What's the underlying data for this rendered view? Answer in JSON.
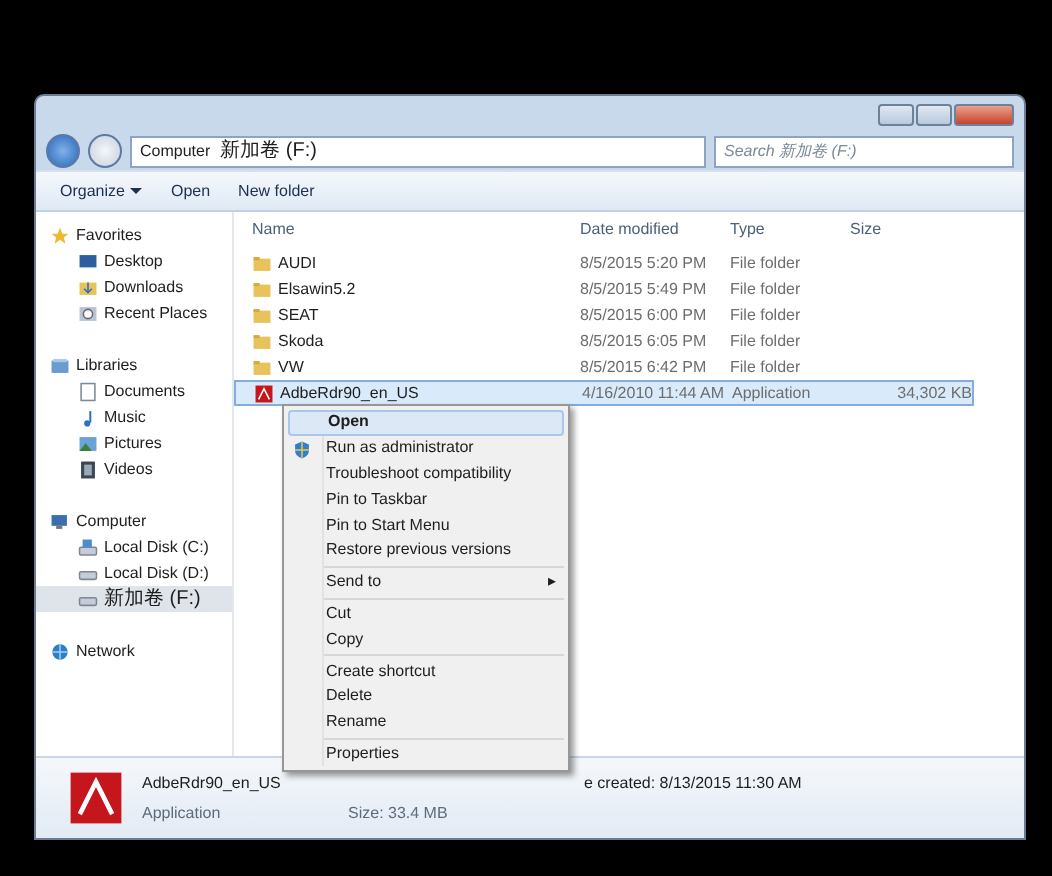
{
  "address": {
    "crumbs": [
      "Computer",
      "新加卷 (F:)"
    ]
  },
  "search": {
    "placeholder": "Search 新加卷 (F:)"
  },
  "toolbar": [
    "Organize",
    "Open",
    "New folder"
  ],
  "sidebar": {
    "groups": [
      {
        "label": "Favorites",
        "children": [
          {
            "label": "Desktop",
            "selected": false
          },
          {
            "label": "Downloads",
            "selected": false
          },
          {
            "label": "Recent Places",
            "selected": false
          }
        ]
      },
      {
        "label": "Libraries",
        "children": [
          {
            "label": "Documents",
            "selected": false
          },
          {
            "label": "Music",
            "selected": false
          },
          {
            "label": "Pictures",
            "selected": false
          },
          {
            "label": "Videos",
            "selected": false
          }
        ]
      },
      {
        "label": "Computer",
        "children": [
          {
            "label": "Local Disk (C:)",
            "selected": false
          },
          {
            "label": "Local Disk (D:)",
            "selected": false
          },
          {
            "label": "新加卷 (F:)",
            "selected": true
          }
        ]
      },
      {
        "label": "Network"
      }
    ]
  },
  "table": {
    "columns": [
      "Name",
      "Date modified",
      "Type",
      "Size"
    ],
    "rows": [
      {
        "kind": "folder",
        "name": "AUDI",
        "date": "8/5/2015 5:20 PM",
        "type": "File folder",
        "size": "",
        "selected": false
      },
      {
        "kind": "folder",
        "name": "Elsawin5.2",
        "date": "8/5/2015 5:49 PM",
        "type": "File folder",
        "size": "",
        "selected": false
      },
      {
        "kind": "folder",
        "name": "SEAT",
        "date": "8/5/2015 6:00 PM",
        "type": "File folder",
        "size": "",
        "selected": false
      },
      {
        "kind": "folder",
        "name": "Skoda",
        "date": "8/5/2015 6:05 PM",
        "type": "File folder",
        "size": "",
        "selected": false
      },
      {
        "kind": "folder",
        "name": "VW",
        "date": "8/5/2015 6:42 PM",
        "type": "File folder",
        "size": "",
        "selected": false
      },
      {
        "kind": "app",
        "name": "AdbeRdr90_en_US",
        "date": "4/16/2010 11:44 AM",
        "type": "Application",
        "size": "34,302 KB",
        "selected": true
      }
    ]
  },
  "context_menu": [
    {
      "kind": "item",
      "label": "Open",
      "selected": true
    },
    {
      "kind": "shield",
      "label": "Run as administrator",
      "selected": false
    },
    {
      "kind": "item",
      "label": "Troubleshoot compatibility",
      "selected": false
    },
    {
      "kind": "item",
      "label": "Pin to Taskbar",
      "selected": false
    },
    {
      "kind": "item",
      "label": "Pin to Start Menu",
      "selected": false
    },
    {
      "kind": "item",
      "label": "Restore previous versions",
      "selected": false
    },
    {
      "kind": "separator"
    },
    {
      "kind": "submenu",
      "label": "Send to",
      "arrow": "▸",
      "selected": false
    },
    {
      "kind": "separator"
    },
    {
      "kind": "item",
      "label": "Cut",
      "selected": false
    },
    {
      "kind": "item",
      "label": "Copy",
      "selected": false
    },
    {
      "kind": "separator"
    },
    {
      "kind": "item",
      "label": "Create shortcut",
      "selected": false
    },
    {
      "kind": "item",
      "label": "Delete",
      "selected": false
    },
    {
      "kind": "item",
      "label": "Rename",
      "selected": false
    },
    {
      "kind": "separator"
    },
    {
      "kind": "item",
      "label": "Properties",
      "selected": false
    }
  ],
  "details": {
    "name": "AdbeRdr90_en_US",
    "type": "Application",
    "size": "Size: 33.4 MB",
    "created": "e created: 8/13/2015 11:30 AM"
  }
}
